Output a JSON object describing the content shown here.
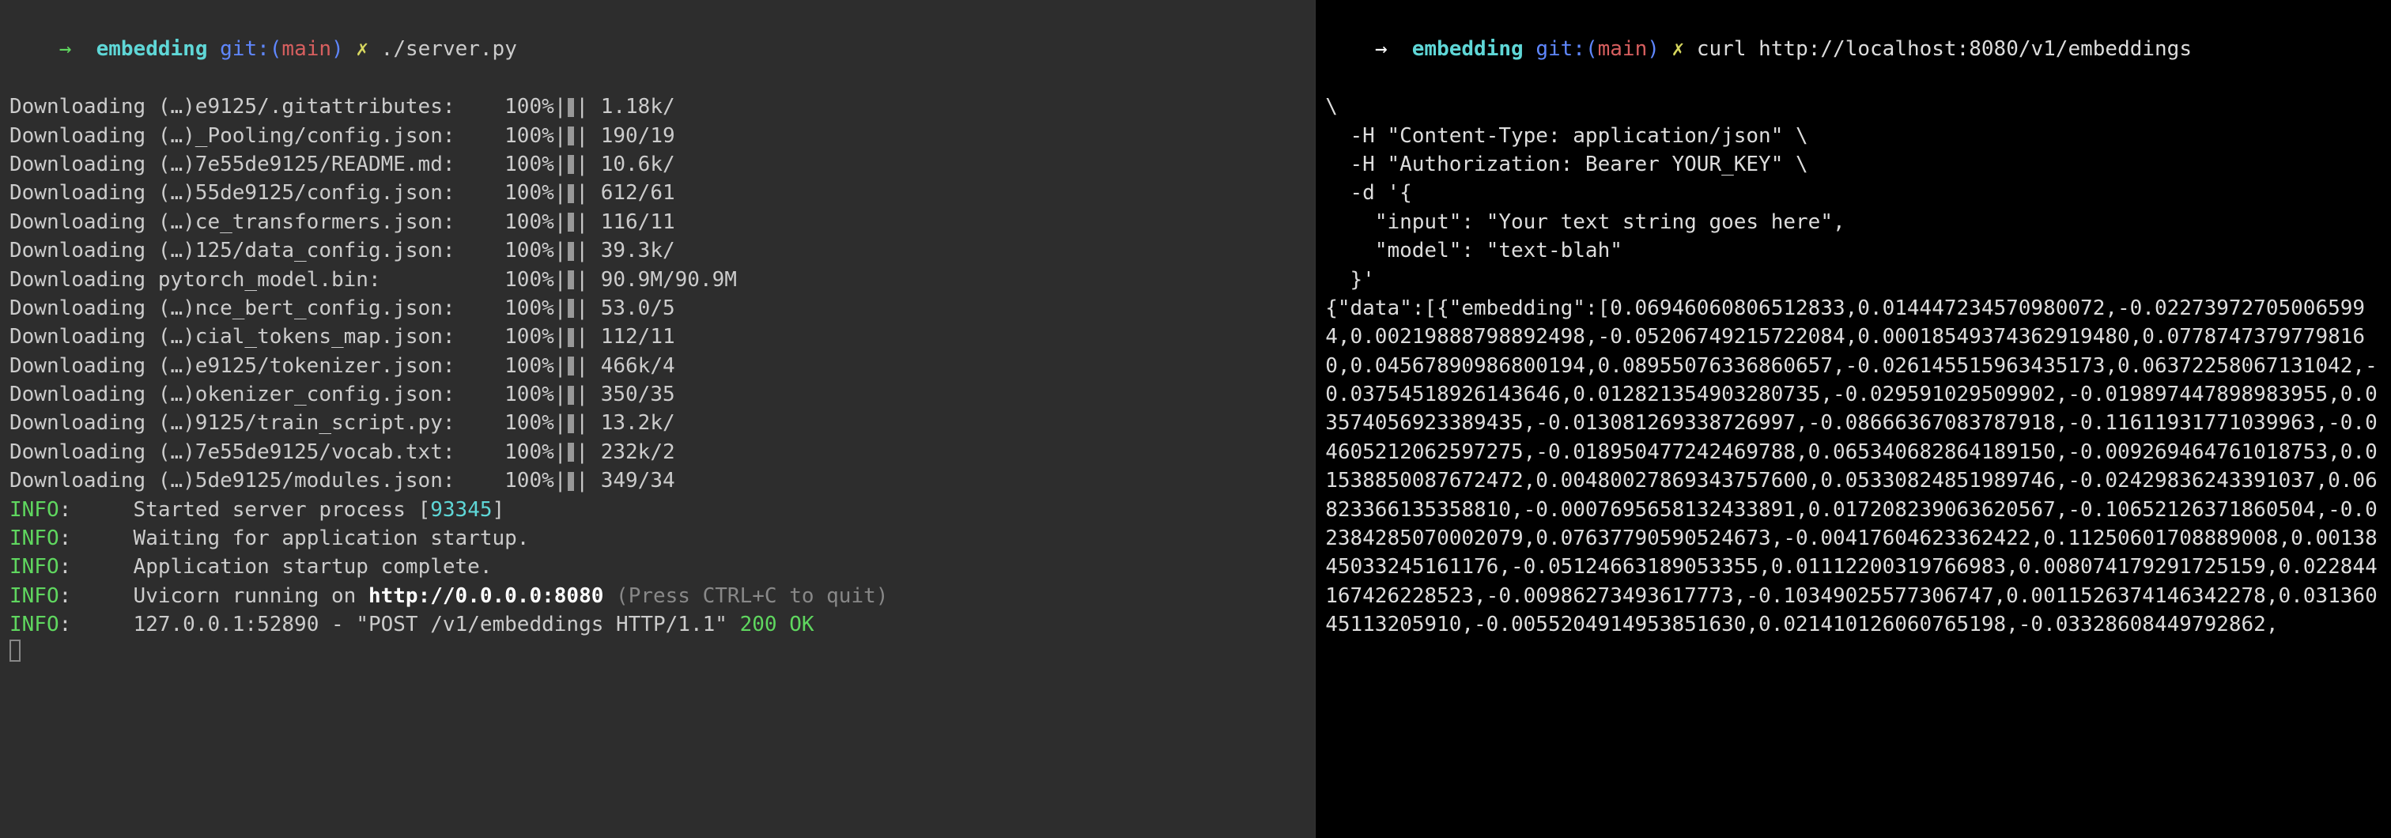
{
  "left": {
    "prompt": {
      "arrow": "→",
      "dir": "embedding",
      "git_label": "git:(",
      "branch": "main",
      "git_close": ")",
      "dirty": "✗",
      "command": "./server.py"
    },
    "downloads": [
      {
        "file": "(…)e9125/.gitattributes",
        "pct": "100%",
        "size": "1.18k/"
      },
      {
        "file": "(…)_Pooling/config.json",
        "pct": "100%",
        "size": "190/19"
      },
      {
        "file": "(…)7e55de9125/README.md",
        "pct": "100%",
        "size": "10.6k/"
      },
      {
        "file": "(…)55de9125/config.json",
        "pct": "100%",
        "size": "612/61"
      },
      {
        "file": "(…)ce_transformers.json",
        "pct": "100%",
        "size": "116/11"
      },
      {
        "file": "(…)125/data_config.json",
        "pct": "100%",
        "size": "39.3k/"
      },
      {
        "file": "pytorch_model.bin",
        "pct": "100%",
        "size": "90.9M/90.9M"
      },
      {
        "file": "(…)nce_bert_config.json",
        "pct": "100%",
        "size": "53.0/5"
      },
      {
        "file": "(…)cial_tokens_map.json",
        "pct": "100%",
        "size": "112/11"
      },
      {
        "file": "(…)e9125/tokenizer.json",
        "pct": "100%",
        "size": "466k/4"
      },
      {
        "file": "(…)okenizer_config.json",
        "pct": "100%",
        "size": "350/35"
      },
      {
        "file": "(…)9125/train_script.py",
        "pct": "100%",
        "size": "13.2k/"
      },
      {
        "file": "(…)7e55de9125/vocab.txt",
        "pct": "100%",
        "size": "232k/2"
      },
      {
        "file": "(…)5de9125/modules.json",
        "pct": "100%",
        "size": "349/34"
      }
    ],
    "info": [
      {
        "text_pre": "Started server process [",
        "pid": "93345",
        "text_post": "]"
      },
      {
        "text_pre": "Waiting for application startup.",
        "pid": "",
        "text_post": ""
      },
      {
        "text_pre": "Application startup complete.",
        "pid": "",
        "text_post": ""
      }
    ],
    "uvicorn": {
      "label": "INFO",
      "pre": "Uvicorn running on ",
      "url": "http://0.0.0.0:8080",
      "post": " (Press CTRL+C to quit)"
    },
    "request": {
      "label": "INFO",
      "ip": "127.0.0.1:52890 - ",
      "quoted": "\"POST /v1/embeddings HTTP/1.1\"",
      "status": "200 OK"
    }
  },
  "right": {
    "prompt": {
      "arrow": "→",
      "dir": "embedding",
      "git_label": "git:(",
      "branch": "main",
      "git_close": ")",
      "dirty": "✗",
      "command": "curl http://localhost:8080/v1/embeddings"
    },
    "curl_lines": [
      "\\",
      "  -H \"Content-Type: application/json\" \\",
      "  -H \"Authorization: Bearer YOUR_KEY\" \\",
      "  -d '{",
      "    \"input\": \"Your text string goes here\",",
      "    \"model\": \"text-blah\"",
      "  }'"
    ],
    "json_response": "{\"data\":[{\"embedding\":[0.06946060806512833,0.014447234570980072,-0.022739727050065994,0.00219888798892498,-0.05206749215722084,0.00018549374362919480,0.07787473797798160,0.04567890986800194,0.08955076336860657,-0.026145515963435173,0.06372258067131042,-0.03754518926143646,0.012821354903280735,-0.029591029509902,-0.019897447898983955,0.03574056923389435,-0.013081269338726997,-0.08666367083787918,-0.11611931771039963,-0.04605212062597275,-0.018950477242469788,0.065340682864189150,-0.009269464761018753,0.01538850087672472,0.00480027869343757600,0.05330824851989746,-0.02429836243391037,0.06823366135358810,-0.0007695658132433891,0.017208239063620567,-0.10652126371860504,-0.02384285070002079,0.07637790590524673,-0.00417604623362422,0.11250601708889008,0.0013845033245161176,-0.05124663189053355,0.01112200319766983,0.008074179291725159,0.022844167426228523,-0.00986273493617773,-0.10349025577306747,0.0011526374146342278,0.03136045113205910,-0.0055204914953851630,0.021410126060765198,-0.03328608449792862,"
  }
}
